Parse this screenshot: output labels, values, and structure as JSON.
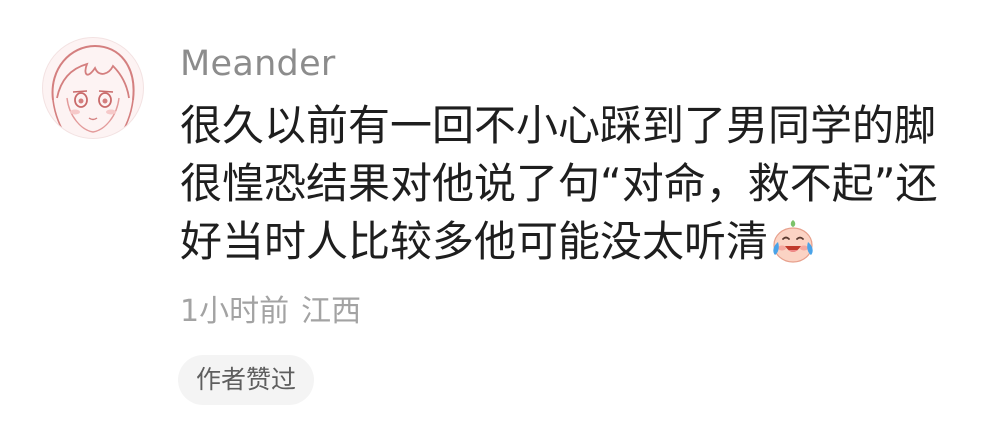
{
  "comment": {
    "username": "Meander",
    "lines": [
      "很久以前有一回不小心踩到了男同学的脚",
      "很惶恐结果对他说了句“对命，救不起”还",
      "好当时人比较多他可能没太听清"
    ],
    "emoji": "crying-laughing-face-icon",
    "time": "1小时前",
    "location": "江西",
    "author_liked": "作者赞过"
  },
  "colors": {
    "username": "#8c8c8c",
    "text": "#1e1e1e",
    "meta": "#a3a3a3",
    "badge_bg": "#f4f4f4",
    "avatar_line": "#d47f7f"
  }
}
